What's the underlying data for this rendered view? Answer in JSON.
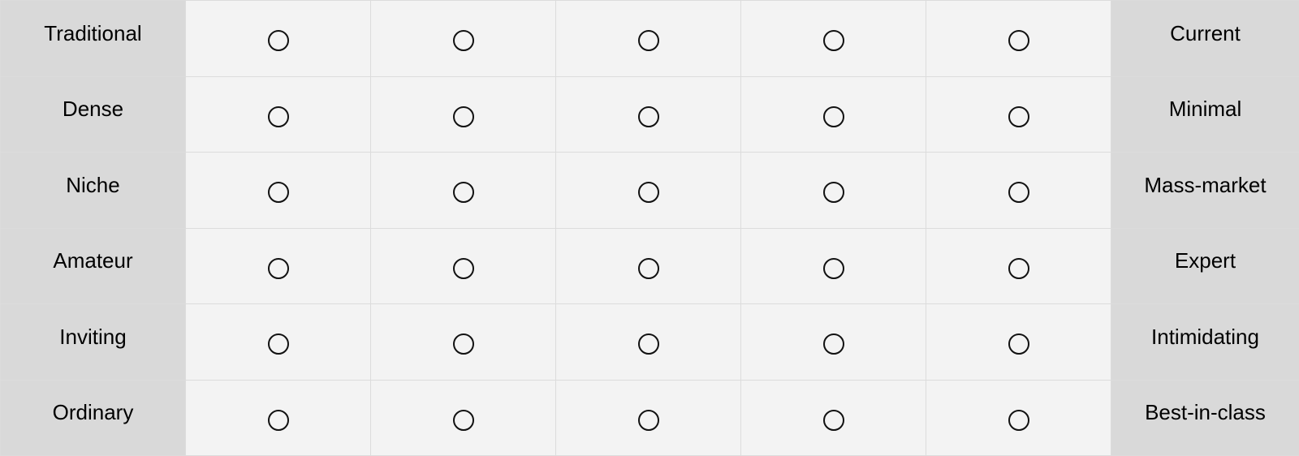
{
  "rows": [
    {
      "left": "Traditional",
      "right": "Current"
    },
    {
      "left": "Dense",
      "right": "Minimal"
    },
    {
      "left": "Niche",
      "right": "Mass-market"
    },
    {
      "left": "Amateur",
      "right": "Expert"
    },
    {
      "left": "Inviting",
      "right": "Intimidating"
    },
    {
      "left": "Ordinary",
      "right": "Best-in-class"
    }
  ],
  "scale_points": 5,
  "colors": {
    "label_bg": "#d9d9d9",
    "cell_bg": "#f3f3f3",
    "grid_line": "#dcdcdc",
    "radio_stroke": "#111111"
  }
}
